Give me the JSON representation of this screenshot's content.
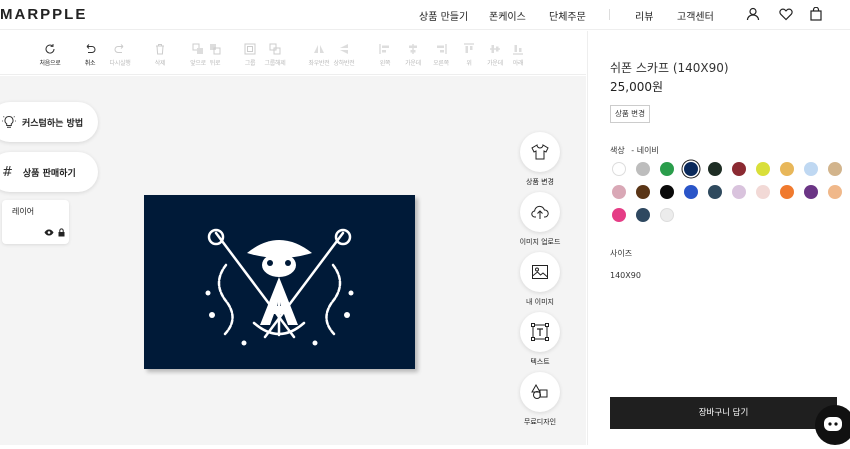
{
  "header": {
    "logo": "MARPPLE",
    "nav": [
      "상품 만들기",
      "폰케이스",
      "단체주문",
      "리뷰",
      "고객센터"
    ],
    "icons": [
      "user-icon",
      "heart-icon",
      "bag-icon"
    ]
  },
  "toolbar": {
    "tools": [
      {
        "label": "처음으로",
        "icon": "reset-icon",
        "enabled": true
      },
      {
        "label": "취소",
        "icon": "undo-icon",
        "enabled": true
      },
      {
        "label": "다시실행",
        "icon": "redo-icon",
        "enabled": false
      },
      {
        "label": "삭제",
        "icon": "trash-icon",
        "enabled": false
      },
      {
        "label": "앞으로",
        "icon": "forward-icon",
        "enabled": false
      },
      {
        "label": "뒤로",
        "icon": "backward-icon",
        "enabled": false
      },
      {
        "label": "그룹",
        "icon": "group-icon",
        "enabled": false
      },
      {
        "label": "그룹해제",
        "icon": "ungroup-icon",
        "enabled": false
      },
      {
        "label": "좌우반전",
        "icon": "flip-h-icon",
        "enabled": false
      },
      {
        "label": "상하반전",
        "icon": "flip-v-icon",
        "enabled": false
      },
      {
        "label": "왼쪽",
        "icon": "align-left-icon",
        "enabled": false
      },
      {
        "label": "가운데",
        "icon": "align-center-icon",
        "enabled": false
      },
      {
        "label": "오른쪽",
        "icon": "align-right-icon",
        "enabled": false
      },
      {
        "label": "위",
        "icon": "align-top-icon",
        "enabled": false
      },
      {
        "label": "가운데",
        "icon": "align-middle-icon",
        "enabled": false
      },
      {
        "label": "아래",
        "icon": "align-bottom-icon",
        "enabled": false
      }
    ]
  },
  "left": {
    "howto": "커스텀하는 방법",
    "sell": "상품 판매하기",
    "layer_title": "레이어"
  },
  "side_tools": [
    {
      "label": "상품 변경",
      "icon": "tshirt-icon"
    },
    {
      "label": "이미지 업로드",
      "icon": "upload-icon"
    },
    {
      "label": "내 이미지",
      "icon": "image-icon"
    },
    {
      "label": "텍스트",
      "icon": "text-icon"
    },
    {
      "label": "무료디자인",
      "icon": "shapes-icon"
    }
  ],
  "product": {
    "title": "쉬폰 스카프 (140X90)",
    "price": "25,000원",
    "change_label": "상품 변경",
    "color_label": "색상",
    "color_selected": "- 네이비",
    "size_label": "사이즈",
    "size_value": "140X90",
    "cart_label": "장바구니 담기",
    "colors": [
      "#ffffff",
      "#bdbdbd",
      "#2a9d4b",
      "#0b2a5c",
      "#1e2d24",
      "#8b2a32",
      "#d9df3a",
      "#e8b75a",
      "#bfd8f2",
      "#d2b48c",
      "#d9a8b6",
      "#5a3516",
      "#0a0a0a",
      "#2a55c8",
      "#2f4a5e",
      "#d9c3dd",
      "#f2d9d6",
      "#f07a2e",
      "#6b3585",
      "#f0b88a",
      "#e53d86",
      "#2e4860",
      "#ececec"
    ],
    "selected_index": 3
  }
}
